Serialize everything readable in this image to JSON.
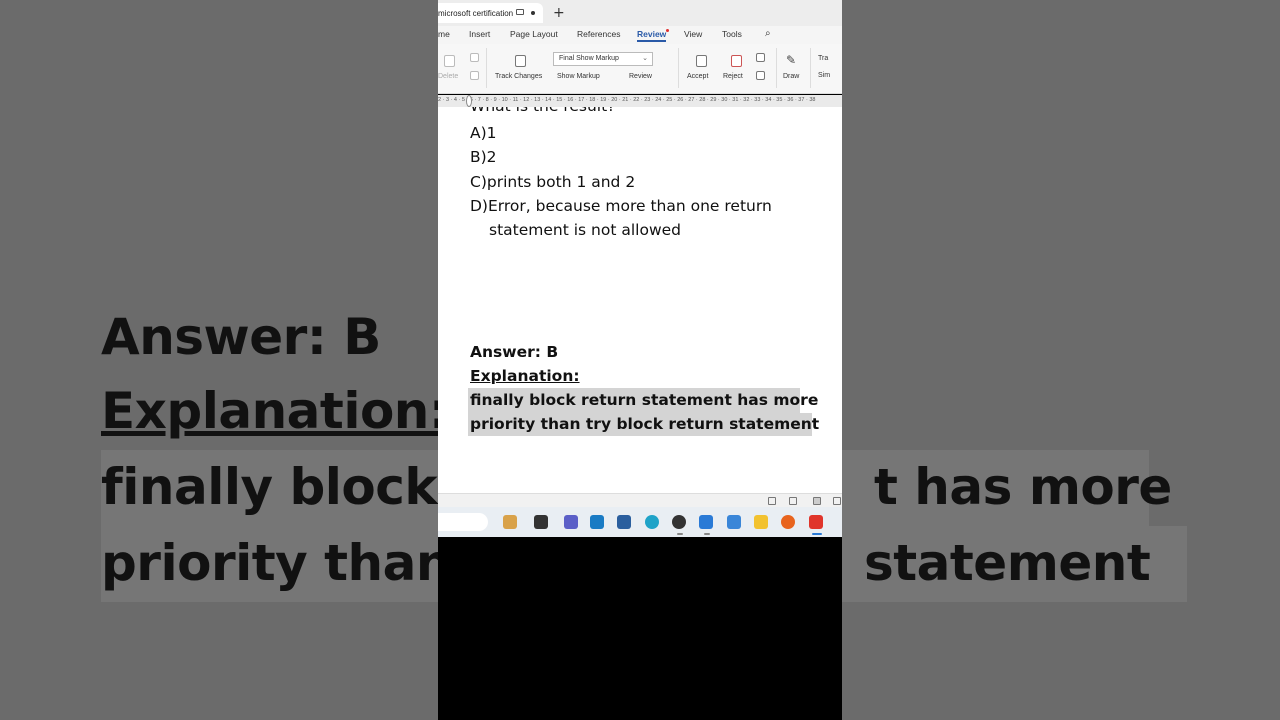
{
  "window": {
    "tab_title": "microsoft certification",
    "new_tab_symbol": "+"
  },
  "menu": {
    "items": [
      "me",
      "Insert",
      "Page Layout",
      "References",
      "Review",
      "View",
      "Tools"
    ],
    "active": "Review"
  },
  "ribbon": {
    "delete_label": "Delete",
    "display_for_review": "Final Show Markup",
    "track_changes": "Track Changes",
    "show_markup": "Show Markup",
    "review": "Review",
    "accept": "Accept",
    "reject": "Reject",
    "draw": "Draw",
    "track_truncated": "Tra",
    "simple_truncated": "Sim"
  },
  "ruler": {
    "ticks": "2 · 3 · 4 · 5 · 6 · 7 · 8 · 9 · 10 · 11 · 12 · 13 · 14 · 15 · 16 · 17 · 18 · 19 · 20 · 21 · 22 · 23 · 24 · 25 · 26 · 27 · 28 · 29 · 30 · 31 · 32 · 33 · 34 · 35 · 36 · 37 · 38"
  },
  "document": {
    "question_cut": "What is the result?",
    "options": [
      "A)1",
      "B)2",
      "C)prints both 1 and 2",
      "D)Error, because more than one return"
    ],
    "option_d_cont": "statement is not allowed",
    "answer": "Answer: B",
    "explanation_label": "Explanation:",
    "explanation_line1": "finally block return statement has more",
    "explanation_line2": "priority than try block return statement"
  },
  "background": {
    "answer": "Answer: B",
    "explanation_label": "Explanation:",
    "left_line1": "finally block r",
    "left_line2": "priority than",
    "right_line1": "t has more",
    "right_line2": "statement"
  },
  "taskbar": {
    "apps": [
      "file-explorer-icon",
      "terminal-icon",
      "teams-icon",
      "dell-icon",
      "store-icon",
      "edge-icon",
      "photos-icon",
      "vscode-icon",
      "notepad-icon",
      "folder-icon",
      "firefox-icon",
      "wps-icon"
    ]
  },
  "colors": {
    "accent": "#2a5aa8",
    "highlight": "#d4d4d4",
    "background_side": "#6b6b6b"
  }
}
